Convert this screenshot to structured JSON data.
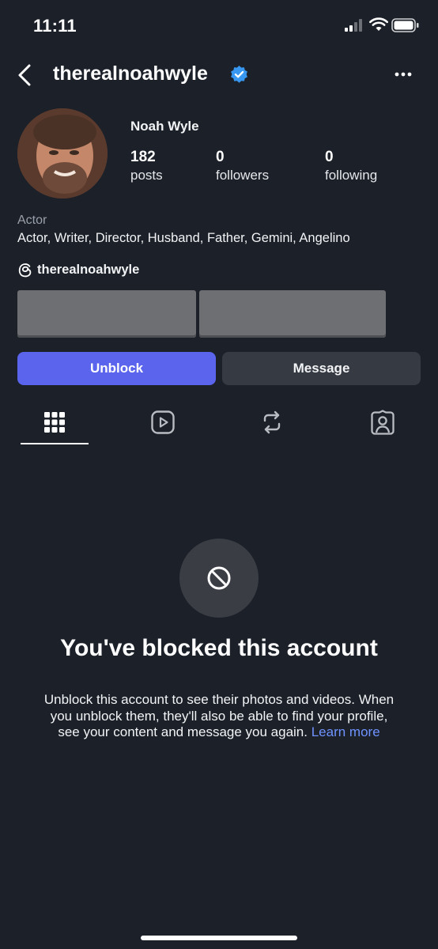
{
  "status_bar": {
    "time": "11:11",
    "icons": [
      "cellular-signal-icon",
      "wifi-icon",
      "battery-icon"
    ]
  },
  "header": {
    "username": "therealnoahwyle",
    "verified": true,
    "icons": [
      "back-chevron-icon",
      "verified-badge-icon",
      "more-options-icon"
    ]
  },
  "profile": {
    "display_name": "Noah Wyle",
    "stats": [
      {
        "value": "182",
        "label": "posts"
      },
      {
        "value": "0",
        "label": "followers"
      },
      {
        "value": "0",
        "label": "following"
      }
    ],
    "category": "Actor",
    "bio": "Actor, Writer, Director, Husband, Father, Gemini, Angelino",
    "threads_handle": "therealnoahwyle"
  },
  "actions": {
    "primary_label": "Unblock",
    "secondary_label": "Message"
  },
  "tabs": [
    {
      "name": "grid",
      "icon": "grid-icon",
      "active": true
    },
    {
      "name": "reels",
      "icon": "reels-icon",
      "active": false
    },
    {
      "name": "reposts",
      "icon": "repost-icon",
      "active": false
    },
    {
      "name": "tagged",
      "icon": "tagged-icon",
      "active": false
    }
  ],
  "blocked_notice": {
    "icon": "block-icon",
    "title": "You've blocked this account",
    "description": "Unblock this account to see their photos and videos. When you unblock them, they'll also be able to find your profile, see your content and message you again.",
    "link_label": "Learn more"
  },
  "colors": {
    "background": "#1b2029",
    "primary_button": "#5a64ec",
    "secondary_button": "#363a43",
    "link": "#6f93ff",
    "verified": "#3897f0"
  }
}
